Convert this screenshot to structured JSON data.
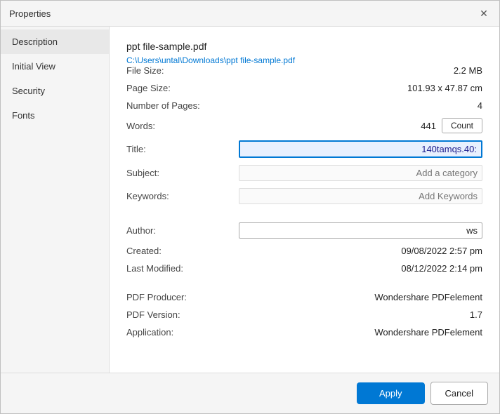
{
  "dialog": {
    "title": "Properties",
    "close_icon": "✕"
  },
  "sidebar": {
    "items": [
      {
        "id": "description",
        "label": "Description",
        "active": true
      },
      {
        "id": "initial-view",
        "label": "Initial View",
        "active": false
      },
      {
        "id": "security",
        "label": "Security",
        "active": false
      },
      {
        "id": "fonts",
        "label": "Fonts",
        "active": false
      }
    ]
  },
  "content": {
    "file_name": "ppt file-sample.pdf",
    "file_path": "C:\\Users\\untal\\Downloads\\ppt file-sample.pdf",
    "properties": {
      "file_size_label": "File Size:",
      "file_size_value": "2.2 MB",
      "page_size_label": "Page Size:",
      "page_size_value": "101.93 x 47.87 cm",
      "num_pages_label": "Number of Pages:",
      "num_pages_value": "4",
      "words_label": "Words:",
      "words_value": "441",
      "count_button": "Count",
      "title_label": "Title:",
      "title_value": "140tamqs.40:",
      "subject_label": "Subject:",
      "subject_placeholder": "Add a category",
      "keywords_label": "Keywords:",
      "keywords_placeholder": "Add Keywords",
      "author_label": "Author:",
      "author_value": "ws",
      "created_label": "Created:",
      "created_value": "09/08/2022 2:57 pm",
      "last_modified_label": "Last Modified:",
      "last_modified_value": "08/12/2022 2:14 pm",
      "pdf_producer_label": "PDF Producer:",
      "pdf_producer_value": "Wondershare PDFelement",
      "pdf_version_label": "PDF Version:",
      "pdf_version_value": "1.7",
      "application_label": "Application:",
      "application_value": "Wondershare PDFelement"
    }
  },
  "footer": {
    "apply_label": "Apply",
    "cancel_label": "Cancel"
  }
}
